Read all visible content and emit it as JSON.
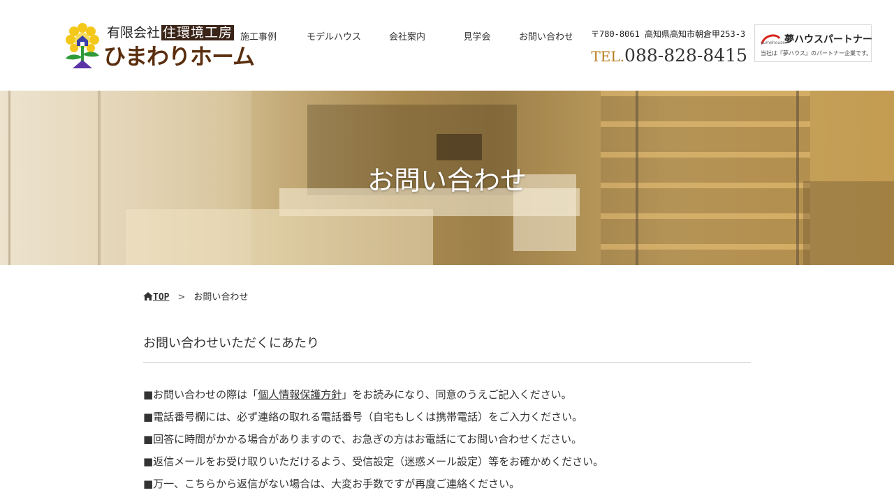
{
  "header": {
    "logo": {
      "company_prefix": "有限会社",
      "company_boxed": "住環境工房",
      "brand_main": "ひまわりホ",
      "brand_accent": "り",
      "brand_full": "ひまわりホーム"
    },
    "nav": [
      {
        "label": "施工事例"
      },
      {
        "label": "モデルハウス"
      },
      {
        "label": "会社案内"
      },
      {
        "label": "見学会"
      },
      {
        "label": "お問い合わせ"
      }
    ],
    "contact": {
      "address": "〒780-8061 高知県高知市朝倉甲253-3",
      "tel_label": "TEL.",
      "tel_number": "088-828-8415"
    },
    "partner_badge": {
      "small": "yumehouse",
      "name": "夢ハウスパートナー",
      "note": "当社は『夢ハウス』のパートナー企業です。"
    }
  },
  "hero": {
    "title": "お問い合わせ"
  },
  "breadcrumb": {
    "home": "TOP",
    "separator": ">",
    "current": "お問い合わせ"
  },
  "section": {
    "title": "お問い合わせいただくにあたり"
  },
  "notes": {
    "item1_before": "■お問い合わせの際は「",
    "item1_link": "個人情報保護方針",
    "item1_after": "」をお読みになり、同意のうえご記入ください。",
    "item2": "■電話番号欄には、必ず連絡の取れる電話番号（自宅もしくは携帯電話）をご入力ください。",
    "item3": "■回答に時間がかかる場合がありますので、お急ぎの方はお電話にてお問い合わせください。",
    "item4": "■返信メールをお受け取りいただけるよう、受信設定（迷惑メール設定）等をお確かめください。",
    "item5": "■万一、こちらから返信がない場合は、大変お手数ですが再度ご連絡ください。"
  },
  "colors": {
    "tel_label": "#b57a1a",
    "brand_brown": "#5a2e0e",
    "brand_red": "#e0421e",
    "divider": "#cccccc"
  }
}
